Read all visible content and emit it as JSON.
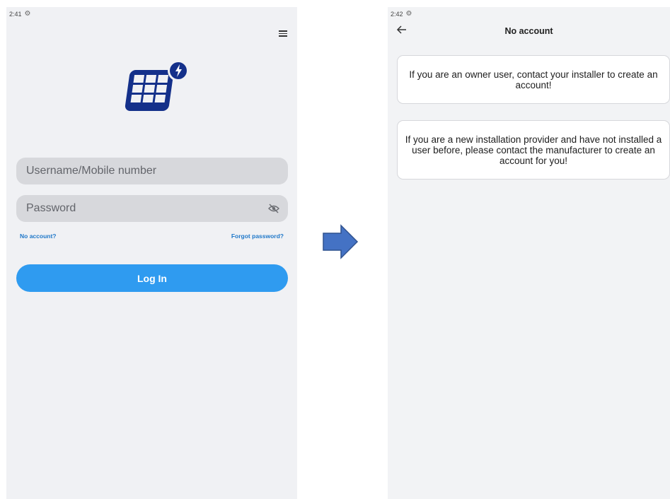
{
  "left_screen": {
    "status_time": "2:41",
    "username_placeholder": "Username/Mobile number",
    "password_placeholder": "Password",
    "no_account_link": "No account?",
    "forgot_password_link": "Forgot password?",
    "login_button": "Log In"
  },
  "right_screen": {
    "status_time": "2:42",
    "title": "No account",
    "messages": [
      "If you are an owner user, contact your installer to create an account!",
      "If you are a new installation provider and have not installed a user before, please contact the manufacturer to create an account for you!"
    ]
  },
  "icons": {
    "status": "gear-icon",
    "menu": "hamburger-menu-icon",
    "logo": "solar-panel-lightning-logo",
    "password_toggle": "eye-off-icon",
    "back": "back-arrow-icon",
    "transition": "right-arrow-icon"
  },
  "colors": {
    "primary_blue": "#2f9bf0",
    "logo_navy": "#14308a",
    "link_blue": "#1f78c9",
    "arrow_blue": "#4472c4"
  }
}
